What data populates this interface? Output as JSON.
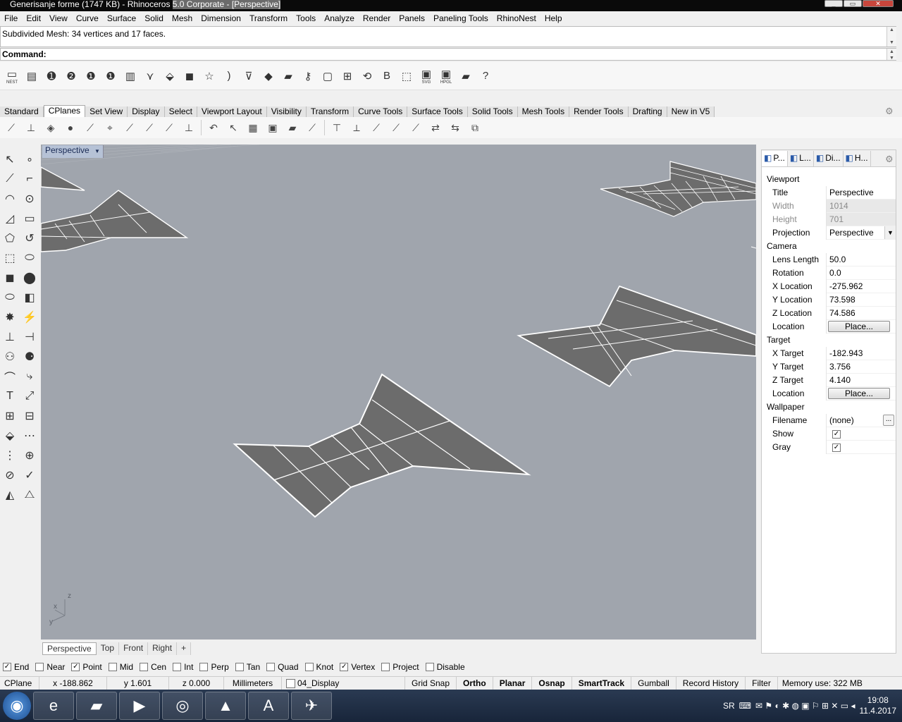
{
  "window": {
    "title_pre": "Generisanje forme (1747 KB) - Rhinoceros ",
    "title_hl": "5.0 Corporate - [Perspective]",
    "min": "_",
    "max": "▭",
    "close": "✕"
  },
  "menu": [
    "File",
    "Edit",
    "View",
    "Curve",
    "Surface",
    "Solid",
    "Mesh",
    "Dimension",
    "Transform",
    "Tools",
    "Analyze",
    "Render",
    "Panels",
    "Paneling Tools",
    "RhinoNest",
    "Help"
  ],
  "history_text": "Subdivided Mesh: 34 vertices and 17 faces.",
  "command_label": "Command:",
  "toolbar1": [
    {
      "icon": "nest-icon",
      "glyph": "▭",
      "label": "NEST"
    },
    {
      "icon": "list-icon",
      "glyph": "▤"
    },
    {
      "icon": "number-1-2-icon",
      "glyph": "➊"
    },
    {
      "icon": "number-2-icon",
      "glyph": "❷"
    },
    {
      "icon": "number-1-icon",
      "glyph": "❶"
    },
    {
      "icon": "number-1-yellow-icon",
      "glyph": "❶"
    },
    {
      "icon": "book-icon",
      "glyph": "▥"
    },
    {
      "icon": "magnet-icon",
      "glyph": "⋎"
    },
    {
      "icon": "transform-icon",
      "glyph": "⬙"
    },
    {
      "icon": "cube-icon",
      "glyph": "◼"
    },
    {
      "icon": "star-outline-icon",
      "glyph": "☆"
    },
    {
      "icon": "rainbow-icon",
      "glyph": ")"
    },
    {
      "icon": "funnel-icon",
      "glyph": "⊽"
    },
    {
      "icon": "blue-shape-icon",
      "glyph": "◆"
    },
    {
      "icon": "folders-icon",
      "glyph": "▰"
    },
    {
      "icon": "key-icon",
      "glyph": "⚷"
    },
    {
      "icon": "select-box-icon",
      "glyph": "▢"
    },
    {
      "icon": "grid-cross-icon",
      "glyph": "⊞"
    },
    {
      "icon": "sync-icon",
      "glyph": "⟲"
    },
    {
      "icon": "letter-b-icon",
      "glyph": "B"
    },
    {
      "icon": "dashed-box-icon",
      "glyph": "⬚"
    },
    {
      "icon": "save-svg-icon",
      "glyph": "▣",
      "label": "SVG"
    },
    {
      "icon": "save-hpgl-icon",
      "glyph": "▣",
      "label": "HPGL"
    },
    {
      "icon": "open-folder-icon",
      "glyph": "▰"
    },
    {
      "icon": "help-icon",
      "glyph": "?"
    }
  ],
  "tabs": [
    "Standard",
    "CPlanes",
    "Set View",
    "Display",
    "Select",
    "Viewport Layout",
    "Visibility",
    "Transform",
    "Curve Tools",
    "Surface Tools",
    "Solid Tools",
    "Mesh Tools",
    "Render Tools",
    "Drafting",
    "New in V5"
  ],
  "active_tab": 1,
  "toolbar2": [
    {
      "icon": "cplane-icon",
      "glyph": "⟋"
    },
    {
      "icon": "cplane-origin-icon",
      "glyph": "⊥"
    },
    {
      "icon": "cplane-object-icon",
      "glyph": "◈"
    },
    {
      "icon": "cplane-sphere-icon",
      "glyph": "●"
    },
    {
      "icon": "cplane-elevation-icon",
      "glyph": "⟋"
    },
    {
      "icon": "cplane-3point-icon",
      "glyph": "⌖"
    },
    {
      "icon": "cplane-x-icon",
      "glyph": "⟋"
    },
    {
      "icon": "cplane-z-icon",
      "glyph": "⟋"
    },
    {
      "icon": "cplane-view-icon",
      "glyph": "⟋"
    },
    {
      "icon": "cplane-vertical-icon",
      "glyph": "⊥"
    },
    {
      "icon": "undo-cplane-icon",
      "glyph": "↶"
    },
    {
      "icon": "cursor-icon",
      "glyph": "↖"
    },
    {
      "icon": "grid-icon",
      "glyph": "▦"
    },
    {
      "icon": "save-cplane-icon",
      "glyph": "▣"
    },
    {
      "icon": "open-cplane-icon",
      "glyph": "▰"
    },
    {
      "icon": "cplane-edit-icon",
      "glyph": "⟋"
    },
    {
      "icon": "cplane-top-icon",
      "glyph": "⊤"
    },
    {
      "icon": "cplane-bottom-icon",
      "glyph": "⟂"
    },
    {
      "icon": "cplane-left-icon",
      "glyph": "⟋"
    },
    {
      "icon": "cplane-right-icon",
      "glyph": "⟋"
    },
    {
      "icon": "cplane-front-icon",
      "glyph": "⟋"
    },
    {
      "icon": "cplane-arrows-icon",
      "glyph": "⇄"
    },
    {
      "icon": "cplane-back-icon",
      "glyph": "⇆"
    },
    {
      "icon": "cplane-named-icon",
      "glyph": "⧉"
    }
  ],
  "left_tools": [
    "↖",
    "∘",
    "⟋",
    "⌐",
    "◠",
    "⊙",
    "◿",
    "▭",
    "⬠",
    "↺",
    "⬚",
    "⬭",
    "◼",
    "⬤",
    "⬭",
    "◧",
    "✸",
    "⚡",
    "⊥",
    "⊣",
    "⚇",
    "⚈",
    "⌒",
    "⤷",
    "T",
    "⤢",
    "⊞",
    "⊟",
    "⬙",
    "⋯",
    "⋮",
    "⊕",
    "⊘",
    "✓",
    "◭",
    "⧍"
  ],
  "viewport": {
    "label": "Perspective",
    "menu_arrow": "▼",
    "axis_x": "x",
    "axis_y": "y",
    "axis_z": "z"
  },
  "viewport_tabs": [
    "Perspective",
    "Top",
    "Front",
    "Right",
    "+"
  ],
  "panel": {
    "tabs": [
      {
        "icon": "properties-icon",
        "label": "P..."
      },
      {
        "icon": "layers-icon",
        "label": "L..."
      },
      {
        "icon": "display-icon",
        "label": "Di..."
      },
      {
        "icon": "help-panel-icon",
        "label": "H..."
      }
    ],
    "sections": [
      {
        "title": "Viewport",
        "rows": [
          {
            "k": "Title",
            "v": "Perspective"
          },
          {
            "k": "Width",
            "v": "1014",
            "disabled": true
          },
          {
            "k": "Height",
            "v": "701",
            "disabled": true
          },
          {
            "k": "Projection",
            "v": "Perspective",
            "dropdown": true
          }
        ]
      },
      {
        "title": "Camera",
        "rows": [
          {
            "k": "Lens Length",
            "v": "50.0"
          },
          {
            "k": "Rotation",
            "v": "0.0"
          },
          {
            "k": "X Location",
            "v": "-275.962"
          },
          {
            "k": "Y Location",
            "v": "73.598"
          },
          {
            "k": "Z Location",
            "v": "74.586"
          },
          {
            "k": "Location",
            "button": "Place..."
          }
        ]
      },
      {
        "title": "Target",
        "rows": [
          {
            "k": "X Target",
            "v": "-182.943"
          },
          {
            "k": "Y Target",
            "v": "3.756"
          },
          {
            "k": "Z Target",
            "v": "4.140"
          },
          {
            "k": "Location",
            "button": "Place..."
          }
        ]
      },
      {
        "title": "Wallpaper",
        "rows": [
          {
            "k": "Filename",
            "v": "(none)",
            "browse": "..."
          },
          {
            "k": "Show",
            "checkbox": true
          },
          {
            "k": "Gray",
            "checkbox": true
          }
        ]
      }
    ]
  },
  "osnap": [
    {
      "label": "End",
      "checked": true
    },
    {
      "label": "Near",
      "checked": false
    },
    {
      "label": "Point",
      "checked": true
    },
    {
      "label": "Mid",
      "checked": false
    },
    {
      "label": "Cen",
      "checked": false
    },
    {
      "label": "Int",
      "checked": false
    },
    {
      "label": "Perp",
      "checked": false
    },
    {
      "label": "Tan",
      "checked": false
    },
    {
      "label": "Quad",
      "checked": false
    },
    {
      "label": "Knot",
      "checked": false
    },
    {
      "label": "Vertex",
      "checked": true
    },
    {
      "label": "Project",
      "checked": false
    },
    {
      "label": "Disable",
      "checked": false
    }
  ],
  "status": {
    "cplane": "CPlane",
    "x": "x -188.862",
    "y": "y 1.601",
    "z": "z 0.000",
    "units": "Millimeters",
    "layer": "04_Display",
    "toggles": [
      {
        "label": "Grid Snap",
        "bold": false
      },
      {
        "label": "Ortho",
        "bold": true
      },
      {
        "label": "Planar",
        "bold": true
      },
      {
        "label": "Osnap",
        "bold": true
      },
      {
        "label": "SmartTrack",
        "bold": true
      },
      {
        "label": "Gumball",
        "bold": false
      },
      {
        "label": "Record History",
        "bold": false
      },
      {
        "label": "Filter",
        "bold": false
      }
    ],
    "memory": "Memory use: 322 MB"
  },
  "taskbar": {
    "apps": [
      {
        "icon": "start-orb-icon",
        "glyph": "◉"
      },
      {
        "icon": "internet-explorer-icon",
        "glyph": "e"
      },
      {
        "icon": "file-explorer-icon",
        "glyph": "▰"
      },
      {
        "icon": "media-player-icon",
        "glyph": "▶"
      },
      {
        "icon": "chrome-icon",
        "glyph": "◎"
      },
      {
        "icon": "3ds-max-icon",
        "glyph": "▲"
      },
      {
        "icon": "autocad-icon",
        "glyph": "A"
      },
      {
        "icon": "rhino-icon",
        "glyph": "✈"
      }
    ],
    "lang": "SR",
    "time": "19:08",
    "date": "11.4.2017"
  },
  "colors": {
    "viewport_bg": "#a0a5ad",
    "mesh_fill": "#6e6e6e",
    "mesh_edge": "#ffffff",
    "taskbar": "#1c2a40"
  }
}
